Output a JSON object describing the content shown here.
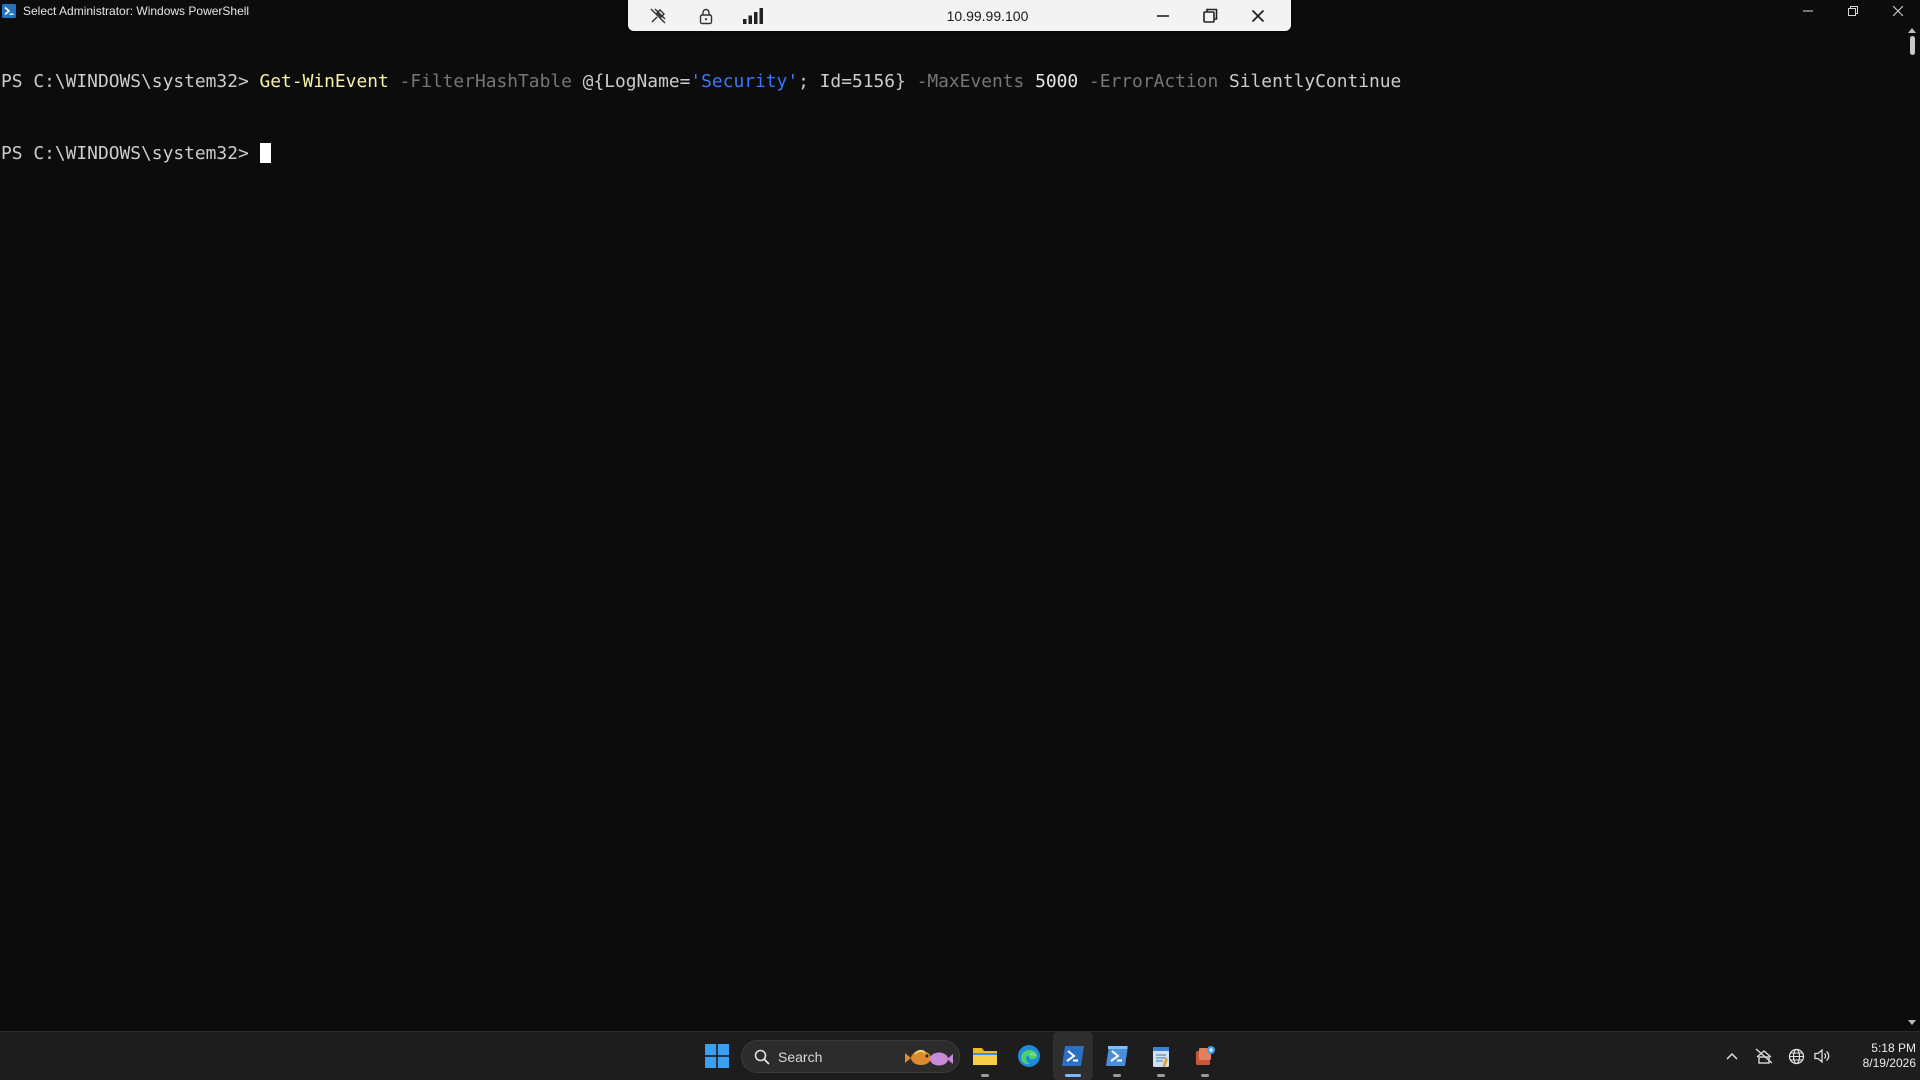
{
  "window": {
    "title": "Select Administrator: Windows PowerShell",
    "icon": "powershell-icon",
    "controls": [
      "minimize-icon",
      "maximize-icon",
      "close-icon"
    ]
  },
  "remote_bar": {
    "host": "10.99.99.100",
    "icons": [
      "unpin-icon",
      "lock-icon",
      "connection-quality-icon",
      "minimize-icon",
      "restore-icon",
      "close-icon"
    ]
  },
  "console": {
    "lines": [
      {
        "prompt": "PS C:\\WINDOWS\\system32> ",
        "command": {
          "cmdlet": "Get-WinEvent",
          "p1": " -FilterHashTable ",
          "h1": "@{LogName=",
          "s1": "'Security'",
          "h2": "; Id=5156}",
          "p2": " -MaxEvents ",
          "n1": "5000",
          "p3": " -ErrorAction ",
          "v1": "SilentlyContinue"
        }
      },
      {
        "prompt": "PS C:\\WINDOWS\\system32> "
      }
    ],
    "colors": {
      "background": "#0c0c0c",
      "text": "#cccccc",
      "cmdlet": "#f9f1a5",
      "parameter": "#767676",
      "string": "#3b78ff"
    }
  },
  "taskbar": {
    "search_label": "Search",
    "apps": [
      "windows-start-icon",
      "file-explorer-icon",
      "edge-icon",
      "powershell-icon",
      "powershell-ise-icon",
      "notepad-icon",
      "app-icon"
    ],
    "tray": [
      "chevron-up-icon",
      "network-offline-icon",
      "globe-icon",
      "volume-icon"
    ],
    "time": "5:18 PM",
    "date": "8/19/2026"
  }
}
